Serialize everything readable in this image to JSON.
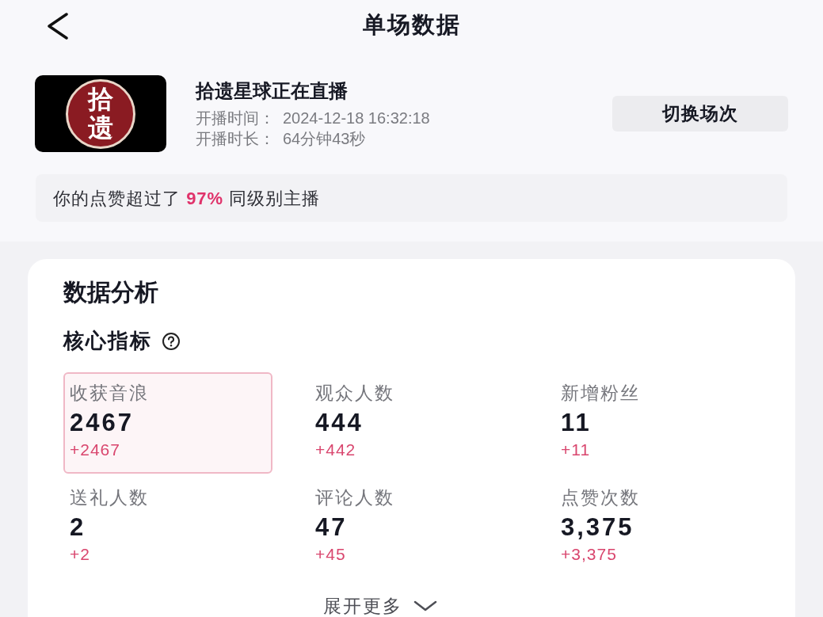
{
  "header": {
    "title": "单场数据"
  },
  "stream": {
    "logo_text": "拾遗",
    "title": "拾遗星球正在直播",
    "start_label": "开播时间：",
    "start_value": "2024-12-18 16:32:18",
    "duration_label": "开播时长：",
    "duration_value": "64分钟43秒",
    "switch_button": "切换场次"
  },
  "banner": {
    "text": "你的点赞超过了 **97%** 同级别主播"
  },
  "analysis": {
    "title": "数据分析",
    "section": "核心指标",
    "metrics": [
      {
        "label": "收获音浪",
        "value": "2467",
        "delta": "+2467",
        "selected": true
      },
      {
        "label": "观众人数",
        "value": "444",
        "delta": "+442",
        "selected": false
      },
      {
        "label": "新增粉丝",
        "value": "11",
        "delta": "+11",
        "selected": false
      },
      {
        "label": "送礼人数",
        "value": "2",
        "delta": "+2",
        "selected": false
      },
      {
        "label": "评论人数",
        "value": "47",
        "delta": "+45",
        "selected": false
      },
      {
        "label": "点赞次数",
        "value": "3,375",
        "delta": "+3,375",
        "selected": false
      }
    ],
    "expand": "展开更多"
  }
}
